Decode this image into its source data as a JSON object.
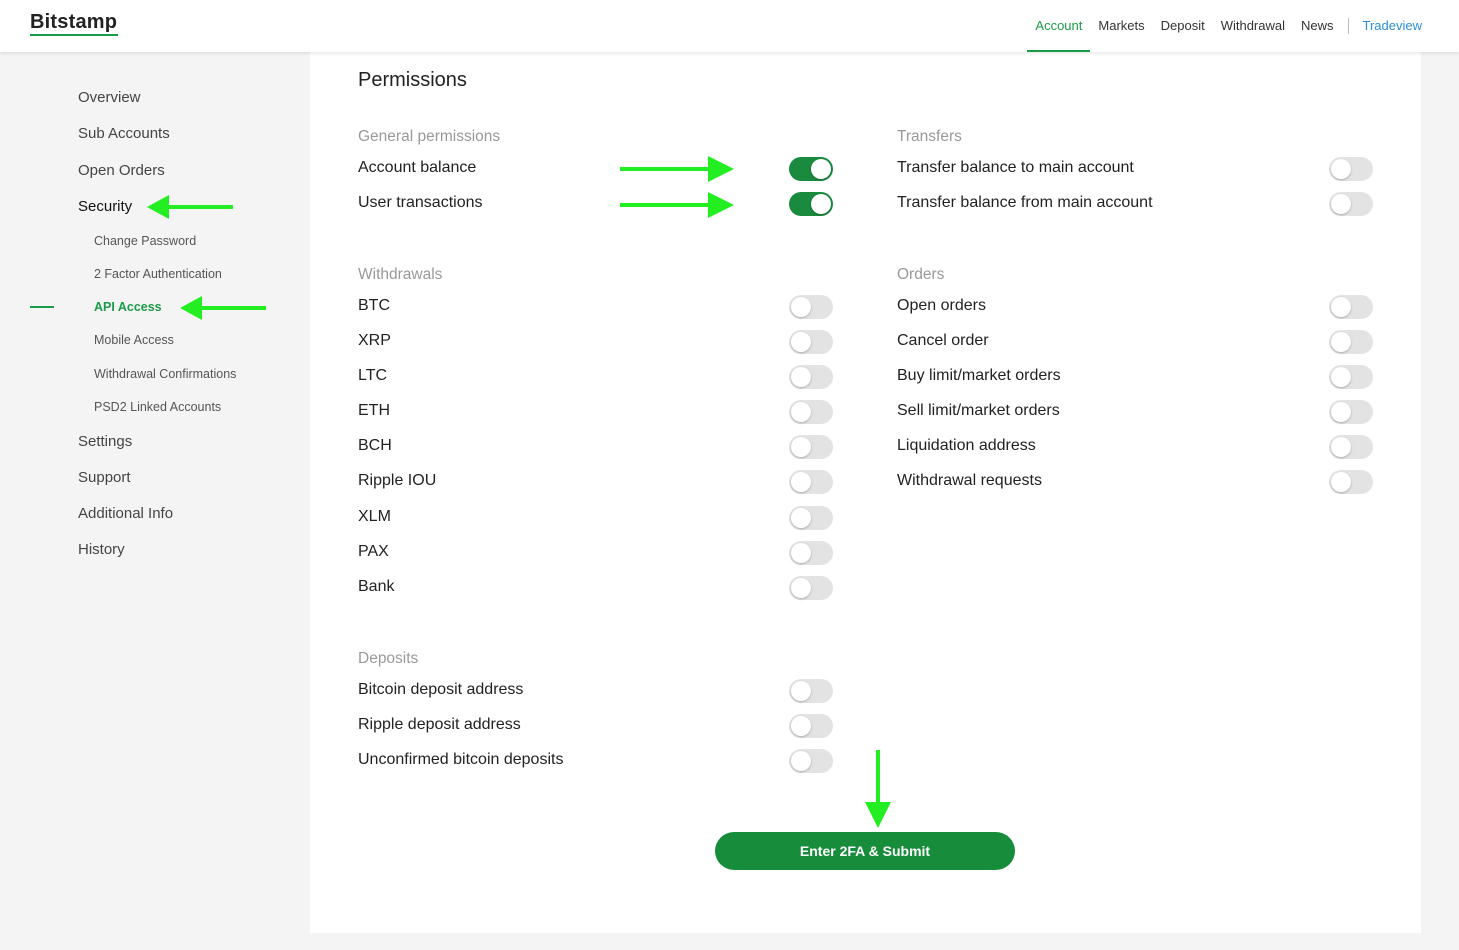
{
  "app": {
    "logo": "Bitstamp"
  },
  "topnav": {
    "items": [
      "Account",
      "Markets",
      "Deposit",
      "Withdrawal",
      "News"
    ],
    "active": "Account",
    "tradeview": "Tradeview"
  },
  "sidebar": {
    "items": [
      "Overview",
      "Sub Accounts",
      "Open Orders",
      "Security"
    ],
    "security_sub": [
      "Change Password",
      "2 Factor Authentication",
      "API Access",
      "Mobile Access",
      "Withdrawal Confirmations",
      "PSD2 Linked Accounts"
    ],
    "items_after": [
      "Settings",
      "Support",
      "Additional Info",
      "History"
    ]
  },
  "permissions": {
    "title": "Permissions",
    "general": {
      "label": "General permissions",
      "rows": [
        {
          "name": "Account balance",
          "on": true
        },
        {
          "name": "User transactions",
          "on": true
        }
      ]
    },
    "transfers": {
      "label": "Transfers",
      "rows": [
        {
          "name": "Transfer balance to main account",
          "on": false
        },
        {
          "name": "Transfer balance from main account",
          "on": false
        }
      ]
    },
    "withdrawals": {
      "label": "Withdrawals",
      "rows": [
        {
          "name": "BTC",
          "on": false
        },
        {
          "name": "XRP",
          "on": false
        },
        {
          "name": "LTC",
          "on": false
        },
        {
          "name": "ETH",
          "on": false
        },
        {
          "name": "BCH",
          "on": false
        },
        {
          "name": "Ripple IOU",
          "on": false
        },
        {
          "name": "XLM",
          "on": false
        },
        {
          "name": "PAX",
          "on": false
        },
        {
          "name": "Bank",
          "on": false
        }
      ]
    },
    "orders": {
      "label": "Orders",
      "rows": [
        {
          "name": "Open orders",
          "on": false
        },
        {
          "name": "Cancel order",
          "on": false
        },
        {
          "name": "Buy limit/market orders",
          "on": false
        },
        {
          "name": "Sell limit/market orders",
          "on": false
        },
        {
          "name": "Liquidation address",
          "on": false
        },
        {
          "name": "Withdrawal requests",
          "on": false
        }
      ]
    },
    "deposits": {
      "label": "Deposits",
      "rows": [
        {
          "name": "Bitcoin deposit address",
          "on": false
        },
        {
          "name": "Ripple deposit address",
          "on": false
        },
        {
          "name": "Unconfirmed bitcoin deposits",
          "on": false
        }
      ]
    },
    "submit_label": "Enter 2FA & Submit"
  },
  "colors": {
    "brand": "#1a9b48",
    "toggle_on": "#1a8b3e",
    "annotation_arrow": "#22ee22",
    "tradeview": "#2a8fd8"
  }
}
